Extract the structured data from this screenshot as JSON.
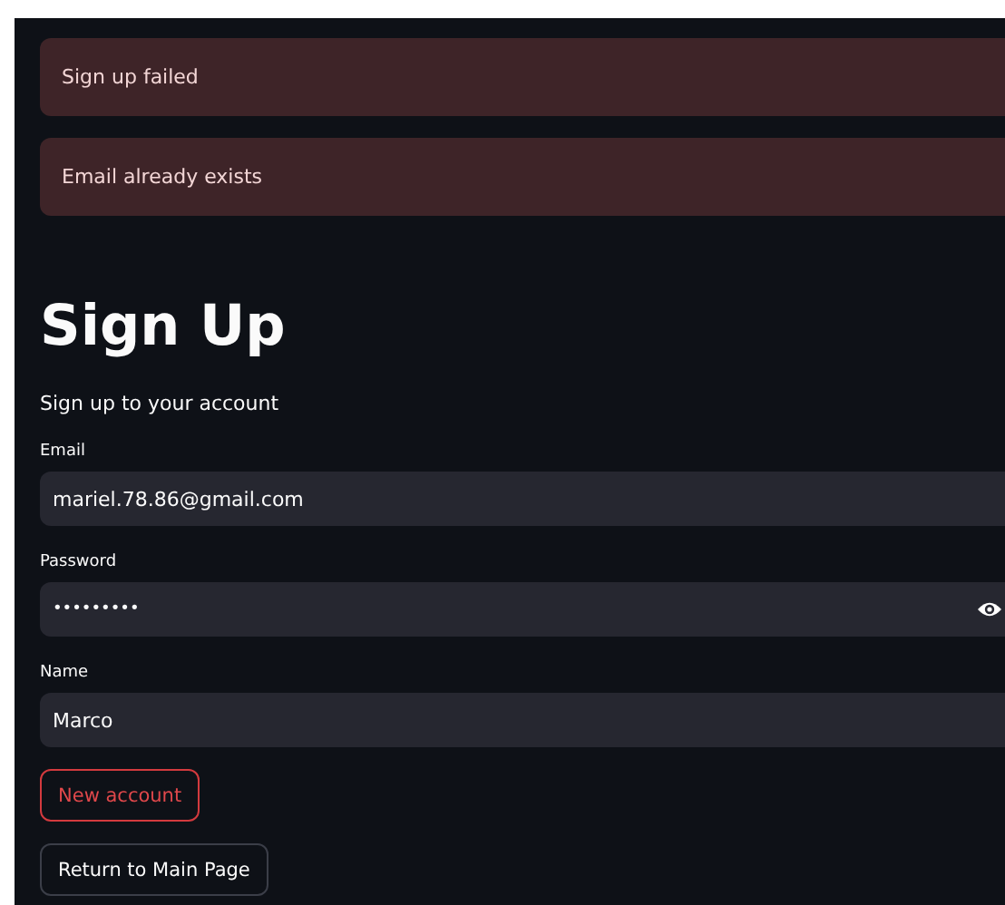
{
  "alerts": [
    {
      "text": "Sign up failed"
    },
    {
      "text": "Email already exists"
    }
  ],
  "heading": "Sign Up",
  "subtitle": "Sign up to your account",
  "fields": [
    {
      "label": "Email",
      "kind": "text",
      "value": "mariel.78.86@gmail.com"
    },
    {
      "label": "Password",
      "kind": "password",
      "value": "•••••••••"
    },
    {
      "label": "Name",
      "kind": "text",
      "value": "Marco"
    }
  ],
  "buttons": [
    {
      "label": "New account",
      "kind": "primary"
    },
    {
      "label": "Return to Main Page",
      "kind": "secondary"
    }
  ]
}
